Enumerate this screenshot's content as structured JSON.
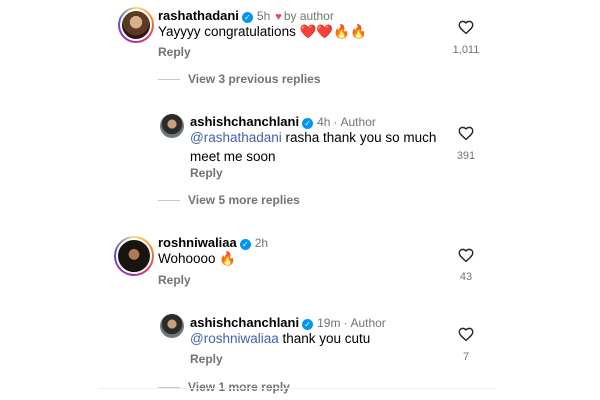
{
  "comments": [
    {
      "username": "rashathadani",
      "time": "5h",
      "liked_by_author": "by author",
      "text": "Yayyyy congratulations ❤️❤️🔥🔥",
      "reply_label": "Reply",
      "likes": "1,011",
      "view_replies": "View 3 previous replies",
      "reply": {
        "username": "ashishchanchlani",
        "time": "4h",
        "badge": "Author",
        "mention": "@rashathadani",
        "text_line1": " rasha thank you so much",
        "text_line2": "meet me soon",
        "reply_label": "Reply",
        "likes": "391"
      },
      "more_replies": "View 5 more replies"
    },
    {
      "username": "roshniwaliaa",
      "time": "2h",
      "text": "Wohoooo 🔥",
      "reply_label": "Reply",
      "likes": "43",
      "reply": {
        "username": "ashishchanchlani",
        "time": "19m",
        "badge": "Author",
        "mention": "@roshniwaliaa",
        "text": " thank you cutu",
        "reply_label": "Reply",
        "likes": "7"
      },
      "more_replies": "View 1 more reply"
    }
  ],
  "icons": {
    "verified": "verified-badge-icon",
    "like": "heart-outline-icon",
    "author_like": "heart-filled-icon"
  },
  "colors": {
    "verified": "#0095f6",
    "mention": "#4361ad",
    "author_heart": "#ed4956",
    "secondary_text": "#737373"
  }
}
